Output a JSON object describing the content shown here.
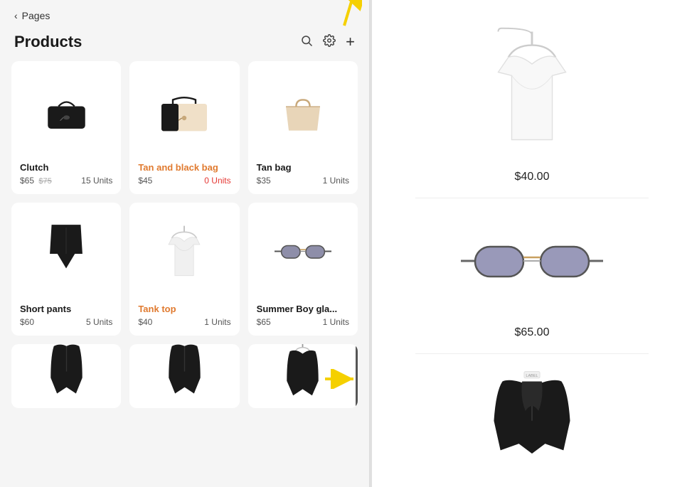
{
  "nav": {
    "back_label": "Pages"
  },
  "header": {
    "title": "Products",
    "icons": {
      "search": "🔍",
      "settings": "⚙",
      "add": "+"
    }
  },
  "products": [
    {
      "id": "clutch",
      "name": "Clutch",
      "price": "$65",
      "original_price": "$75",
      "units": "15 Units",
      "highlight": false,
      "units_red": false,
      "type": "bag-black"
    },
    {
      "id": "tan-black-bag",
      "name": "Tan and black bag",
      "price": "$45",
      "units": "0 Units",
      "highlight": true,
      "units_red": true,
      "type": "bag-tan-black"
    },
    {
      "id": "tan-bag",
      "name": "Tan bag",
      "price": "$35",
      "units": "1 Units",
      "highlight": false,
      "units_red": false,
      "type": "bag-tan"
    }
  ],
  "products_row2": [
    {
      "id": "short-pants",
      "name": "Short pants",
      "price": "$60",
      "units": "5 Units",
      "highlight": false,
      "units_red": false,
      "type": "pants"
    },
    {
      "id": "tank-top",
      "name": "Tank top",
      "price": "$40",
      "units": "1 Units",
      "highlight": true,
      "units_red": false,
      "type": "tank"
    },
    {
      "id": "summer-boy-gla",
      "name": "Summer Boy gla...",
      "price": "$65",
      "units": "1 Units",
      "highlight": false,
      "units_red": false,
      "type": "sunglasses"
    }
  ],
  "detail_items": [
    {
      "type": "tank-detail",
      "price": "$40.00"
    },
    {
      "type": "sunglasses-detail",
      "price": "$65.00"
    },
    {
      "type": "robe-detail",
      "price": ""
    }
  ]
}
